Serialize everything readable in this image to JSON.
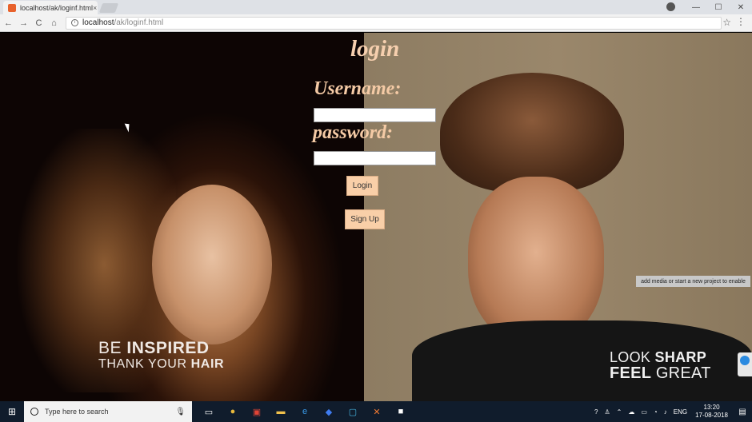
{
  "browser": {
    "tab_title": "localhost/ak/loginf.html",
    "tab_close": "×",
    "url_host": "localhost",
    "url_path": "/ak/loginf.html",
    "window_controls": {
      "minimize": "—",
      "maximize": "☐",
      "close": "✕"
    },
    "nav": {
      "back": "←",
      "forward": "→",
      "reload": "C",
      "home": "⌂"
    }
  },
  "page": {
    "title": "login",
    "username_label": "Username:",
    "password_label": "password:",
    "login_button": "Login",
    "signup_button": "Sign Up",
    "slogan_left": {
      "line1_light": "BE ",
      "line1_bold": "INSPIRED",
      "line2_light": "THANK YOUR ",
      "line2_bold": "HAIR"
    },
    "slogan_right": {
      "line1_light": "LOOK ",
      "line1_bold": "SHARP",
      "line2_bold": "FEEL ",
      "line2_light": "GREAT"
    }
  },
  "overlay_notice": "add media or start a new project to enable",
  "taskbar": {
    "search_placeholder": "Type here to search",
    "language": "ENG",
    "time": "13:20",
    "date": "17-08-2018"
  },
  "colors": {
    "accent_button": "#f9cfa8",
    "label_color": "#f4caa5",
    "taskbar": "#101c2c"
  }
}
